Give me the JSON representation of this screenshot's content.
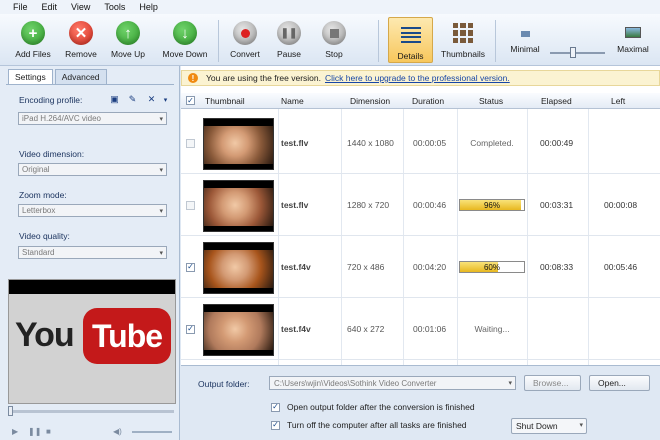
{
  "menu": [
    "File",
    "Edit",
    "View",
    "Tools",
    "Help"
  ],
  "toolbar": {
    "add_files": "Add Files",
    "remove": "Remove",
    "move_up": "Move Up",
    "move_down": "Move Down",
    "convert": "Convert",
    "pause": "Pause",
    "stop": "Stop",
    "details": "Details",
    "thumbnails": "Thumbnails",
    "minimal": "Minimal",
    "maximal": "Maximal"
  },
  "settings": {
    "tabs": [
      "Settings",
      "Advanced"
    ],
    "encoding_label": "Encoding profile:",
    "encoding_value": "iPad H.264/AVC video",
    "dimension_label": "Video dimension:",
    "dimension_value": "Original",
    "zoom_label": "Zoom mode:",
    "zoom_value": "Letterbox",
    "quality_label": "Video quality:",
    "quality_value": "Standard"
  },
  "preview": {
    "logo_you": "You",
    "logo_tube": "Tube"
  },
  "notice": {
    "text": "You are using the free version.",
    "link": "Click here to upgrade to the professional version."
  },
  "columns": {
    "thumbnail": "Thumbnail",
    "name": "Name",
    "dimension": "Dimension",
    "duration": "Duration",
    "status": "Status",
    "elapsed": "Elapsed",
    "left": "Left"
  },
  "rows": [
    {
      "name": "test.flv",
      "dimension": "1440 x 1080",
      "duration": "00:00:05",
      "status": "Completed.",
      "elapsed": "00:00:49",
      "left": "",
      "checked": false,
      "progress": null,
      "thumb_color": "#8a5a3a"
    },
    {
      "name": "test.flv",
      "dimension": "1280 x 720",
      "duration": "00:00:46",
      "status": "",
      "elapsed": "00:03:31",
      "left": "00:00:08",
      "checked": false,
      "progress": "96%",
      "thumb_color": "#9c5838"
    },
    {
      "name": "test.f4v",
      "dimension": "720 x 486",
      "duration": "00:04:20",
      "status": "",
      "elapsed": "00:08:33",
      "left": "00:05:46",
      "checked": true,
      "progress": "60%",
      "thumb_color": "#a8551c"
    },
    {
      "name": "test.f4v",
      "dimension": "640 x 272",
      "duration": "00:01:06",
      "status": "Waiting...",
      "elapsed": "",
      "left": "",
      "checked": true,
      "progress": null,
      "thumb_color": "#b07a5c"
    }
  ],
  "output": {
    "label": "Output folder:",
    "path": "C:\\Users\\wjin\\Videos\\Sothink Video Converter",
    "browse": "Browse...",
    "open": "Open...",
    "open_folder_text": "Open output folder after the conversion is finished",
    "shutdown_text": "Turn off the computer after all tasks are finished",
    "shutdown_option": "Shut Down"
  }
}
